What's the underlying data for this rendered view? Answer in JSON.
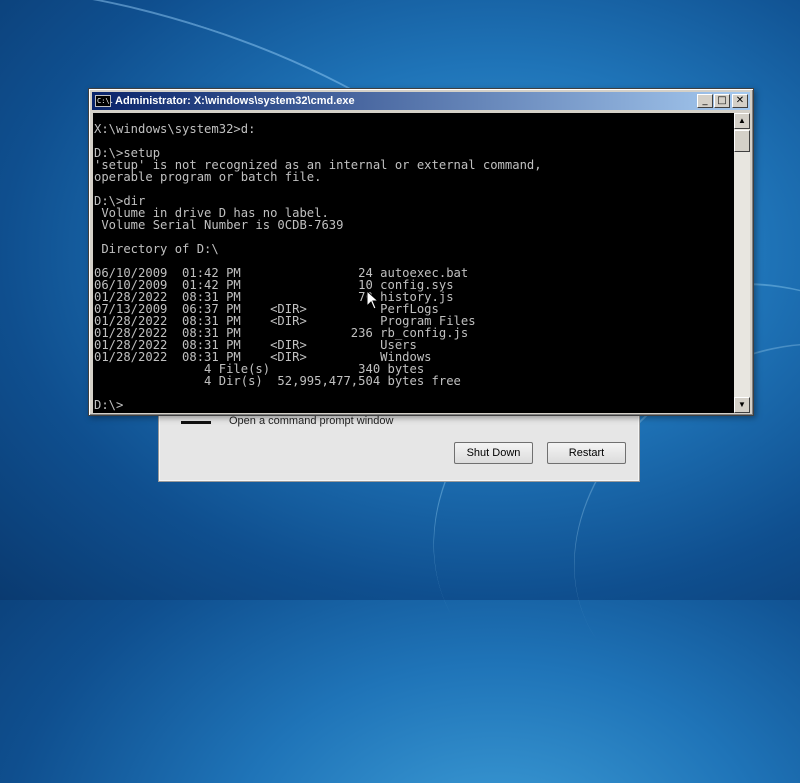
{
  "desktop": {
    "wallpaper": "windows-7-blue-streaks"
  },
  "background_dialog": {
    "option_text": "Open a command prompt window",
    "shutdown_label": "Shut Down",
    "restart_label": "Restart"
  },
  "cmd_window": {
    "title": "Administrator: X:\\windows\\system32\\cmd.exe",
    "icon_text": "C:\\.",
    "controls": {
      "minimize": "_",
      "maximize": "□",
      "close": "✕"
    },
    "console_text": "X:\\windows\\system32>d:\n\nD:\\>setup\n'setup' is not recognized as an internal or external command,\noperable program or batch file.\n\nD:\\>dir\n Volume in drive D has no label.\n Volume Serial Number is 0CDB-7639\n\n Directory of D:\\\n\n06/10/2009  01:42 PM                24 autoexec.bat\n06/10/2009  01:42 PM                10 config.sys\n01/28/2022  08:31 PM                70 history.js\n07/13/2009  06:37 PM    <DIR>          PerfLogs\n01/28/2022  08:31 PM    <DIR>          Program Files\n01/28/2022  08:31 PM               236 rb_config.js\n01/28/2022  08:31 PM    <DIR>          Users\n01/28/2022  08:31 PM    <DIR>          Windows\n               4 File(s)            340 bytes\n               4 Dir(s)  52,995,477,504 bytes free\n\nD:\\>",
    "scrollbar": {
      "up_arrow": "▲",
      "down_arrow": "▼"
    }
  },
  "colors": {
    "console_bg": "#000000",
    "console_text": "#c0c0c0",
    "titlebar_start": "#0a246a",
    "titlebar_end": "#a6caf0"
  }
}
